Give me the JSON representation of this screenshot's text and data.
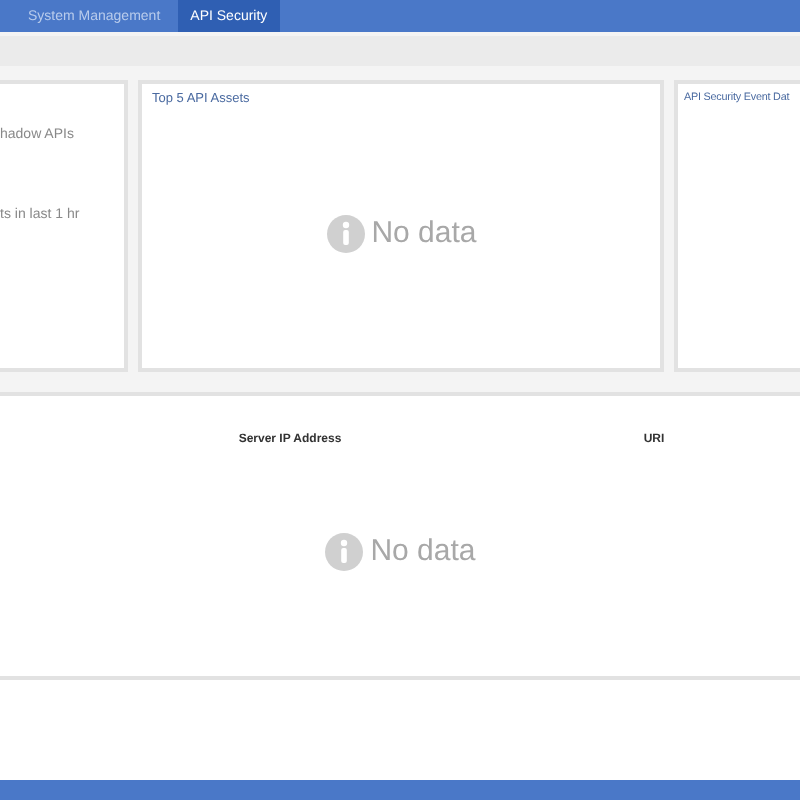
{
  "nav": {
    "tabs": [
      {
        "label": "System Management",
        "selected": false
      },
      {
        "label": "API Security",
        "selected": true
      }
    ]
  },
  "summary_card": {
    "lines": [
      "hadow APIs",
      "ts in last 1 hr"
    ]
  },
  "charts": [
    {
      "title": "Top 5 API Assets",
      "empty_message": "No data"
    },
    {
      "title": "API Security Event Dat"
    }
  ],
  "table": {
    "columns": [
      "Server IP Address",
      "URI"
    ],
    "empty_message": "No data"
  }
}
